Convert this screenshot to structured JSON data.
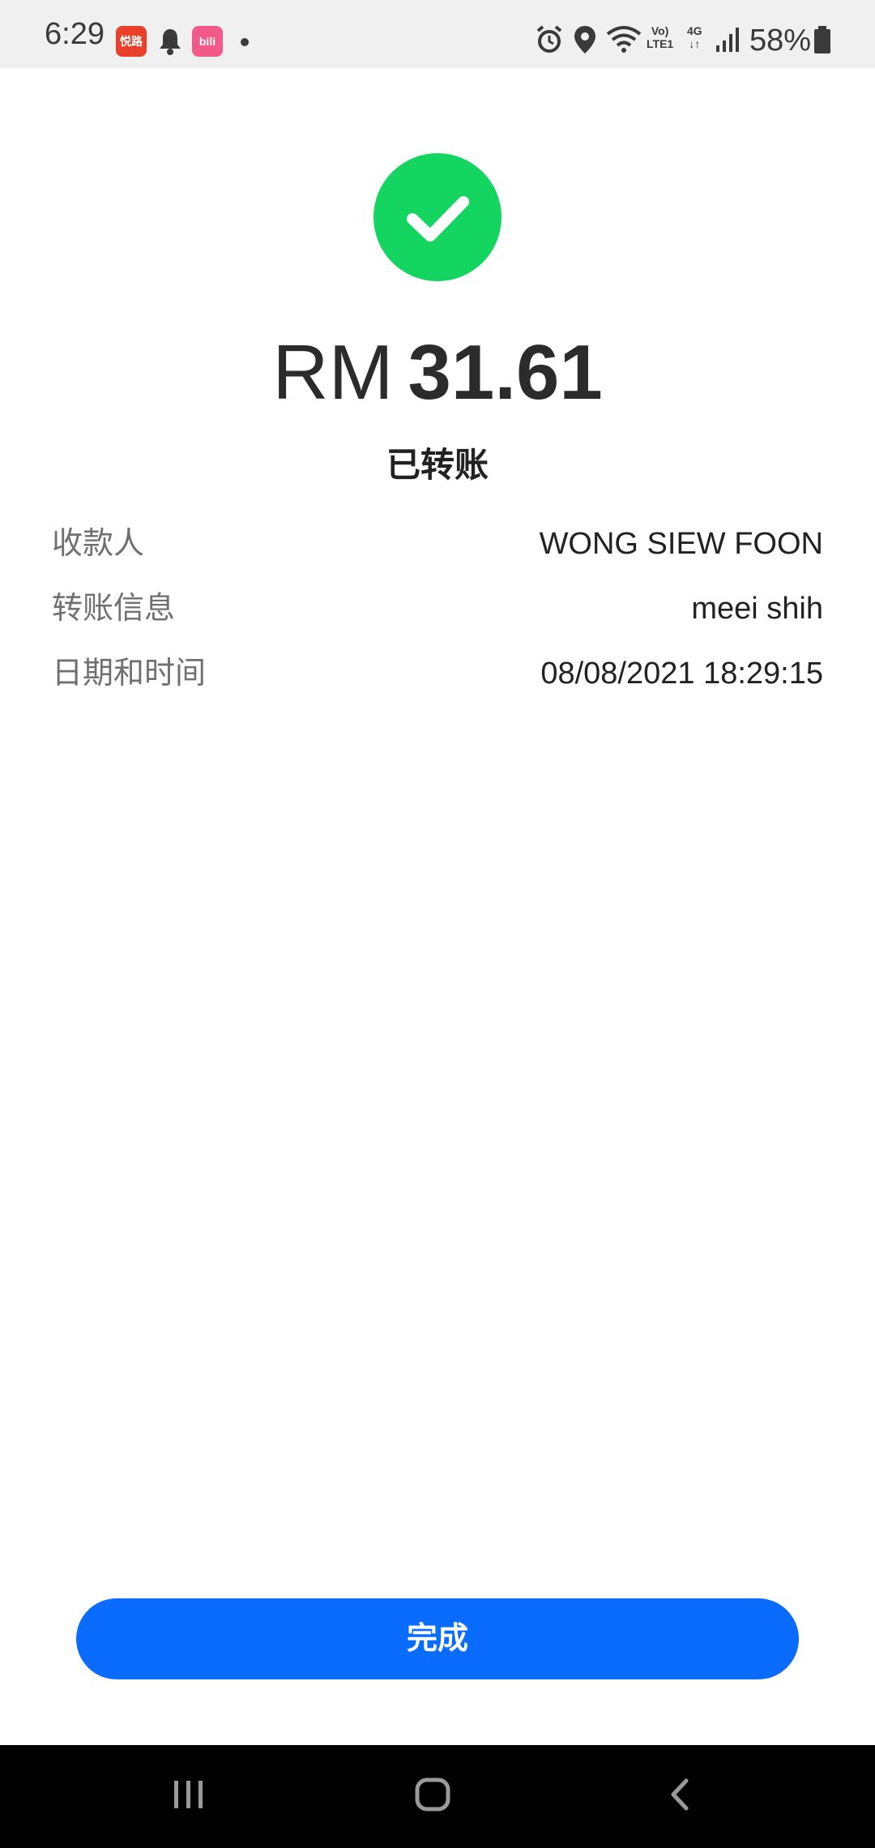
{
  "status_bar": {
    "time": "6:29",
    "app1_label": "悦路",
    "app2_label": "bili",
    "volte_line1": "Vo)",
    "volte_line2": "LTE1",
    "network_type": "4G",
    "battery_percent": "58%"
  },
  "transfer": {
    "currency": "RM",
    "amount": "31.61",
    "status": "已转账"
  },
  "details": [
    {
      "label": "收款人",
      "value": "WONG SIEW FOON"
    },
    {
      "label": "转账信息",
      "value": "meei shih"
    },
    {
      "label": "日期和时间",
      "value": "08/08/2021 18:29:15"
    }
  ],
  "actions": {
    "done_label": "完成"
  },
  "colors": {
    "success_green": "#14d55f",
    "primary_blue": "#0a6cff",
    "status_bar_bg": "#f0f0f0"
  },
  "icons": [
    "bell-icon",
    "alarm-icon",
    "location-pin-icon",
    "wifi-icon",
    "signal-icon",
    "battery-icon",
    "checkmark-icon",
    "recent-apps-icon",
    "home-icon",
    "back-icon"
  ]
}
